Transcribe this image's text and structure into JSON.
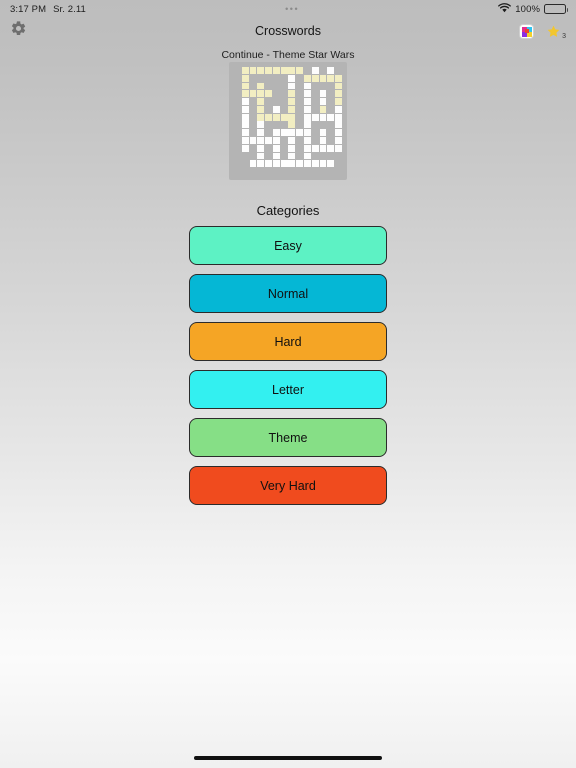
{
  "status_bar": {
    "time": "3:17 PM",
    "carrier": "Sr. 2.11",
    "grabber": "•••",
    "battery_percent": "100%",
    "wifi_icon": "wifi-icon",
    "battery_icon": "battery-icon"
  },
  "nav_bar": {
    "title": "Crosswords",
    "settings_icon": "gear-icon",
    "theme_icon": "palette-icon",
    "star_icon": "star-icon",
    "star_count": "3"
  },
  "continue": {
    "label": "Continue - Theme Star Wars",
    "grid_name": "crossword-preview"
  },
  "categories": {
    "heading": "Categories",
    "items": [
      {
        "label": "Easy",
        "color": "#5df2c4",
        "name": "category-easy"
      },
      {
        "label": "Normal",
        "color": "#05b7d5",
        "name": "category-normal"
      },
      {
        "label": "Hard",
        "color": "#f5a525",
        "name": "category-hard"
      },
      {
        "label": "Letter",
        "color": "#33f0f0",
        "name": "category-letter"
      },
      {
        "label": "Theme",
        "color": "#86df86",
        "name": "category-theme"
      },
      {
        "label": "Very Hard",
        "color": "#f04b1e",
        "name": "category-very-hard"
      }
    ]
  },
  "colors": {
    "cell_filled": "#f2eec2",
    "cell_white": "#fdfdfd",
    "card_background": "#b4b4b4",
    "star": "#f2c62e"
  },
  "crossword_preview": {
    "rows": 14,
    "cols": 14,
    "legend": {
      "0": "blank",
      "1": "white",
      "2": "filled"
    },
    "cells": [
      [
        0,
        2,
        2,
        2,
        2,
        2,
        2,
        2,
        2,
        0,
        1,
        0,
        1,
        0
      ],
      [
        0,
        2,
        0,
        0,
        0,
        0,
        0,
        1,
        0,
        2,
        2,
        2,
        2,
        2
      ],
      [
        0,
        2,
        0,
        2,
        0,
        0,
        0,
        1,
        0,
        1,
        0,
        0,
        0,
        2
      ],
      [
        0,
        2,
        2,
        2,
        2,
        0,
        0,
        2,
        0,
        1,
        0,
        1,
        0,
        2
      ],
      [
        0,
        1,
        0,
        2,
        0,
        0,
        0,
        2,
        0,
        1,
        0,
        1,
        0,
        2
      ],
      [
        0,
        1,
        0,
        2,
        0,
        1,
        0,
        2,
        0,
        1,
        0,
        2,
        0,
        1
      ],
      [
        0,
        1,
        0,
        2,
        2,
        2,
        2,
        2,
        0,
        1,
        1,
        1,
        1,
        1
      ],
      [
        0,
        1,
        0,
        1,
        0,
        0,
        0,
        2,
        0,
        1,
        0,
        0,
        0,
        1
      ],
      [
        0,
        1,
        0,
        1,
        0,
        1,
        1,
        1,
        1,
        1,
        0,
        1,
        0,
        1
      ],
      [
        0,
        1,
        1,
        1,
        1,
        1,
        0,
        1,
        0,
        1,
        0,
        1,
        0,
        1
      ],
      [
        0,
        1,
        0,
        1,
        0,
        1,
        0,
        1,
        0,
        1,
        1,
        1,
        1,
        1
      ],
      [
        0,
        0,
        0,
        1,
        0,
        1,
        0,
        1,
        0,
        1,
        0,
        0,
        0,
        0
      ],
      [
        0,
        0,
        1,
        1,
        1,
        1,
        1,
        1,
        1,
        1,
        1,
        1,
        1,
        0
      ],
      [
        0,
        0,
        0,
        0,
        0,
        0,
        0,
        0,
        0,
        0,
        0,
        0,
        0,
        0
      ]
    ]
  },
  "home_indicator": {
    "name": "home-indicator"
  }
}
